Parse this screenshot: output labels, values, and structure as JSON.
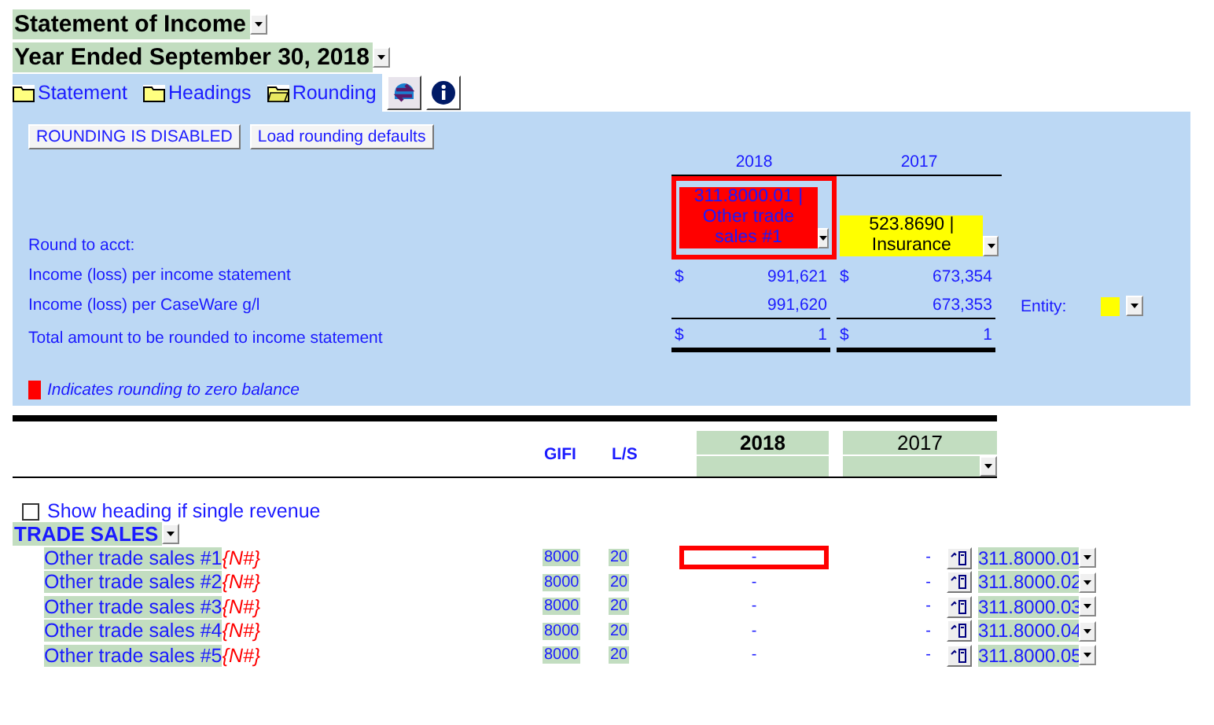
{
  "report_title": "Statement of Income",
  "period": "Year Ended September 30, 2018",
  "tabs": [
    {
      "label": "Statement",
      "selected": false
    },
    {
      "label": "Headings",
      "selected": false
    },
    {
      "label": "Rounding",
      "selected": true
    }
  ],
  "rounding": {
    "buttons": [
      "ROUNDING IS DISABLED",
      "Load rounding defaults"
    ],
    "columns": [
      "2018",
      "2017"
    ],
    "round_to_label": "Round to acct:",
    "round_to": [
      {
        "text": "311.8000.01 | Other trade sales #1",
        "color": "#ff0000",
        "flagged": true
      },
      {
        "text": "523.8690 | Insurance",
        "color": "#ffff00",
        "flagged": false
      }
    ],
    "rows": [
      {
        "label": "Income (loss) per income statement",
        "kind": "dollar",
        "values": [
          {
            "currency": "$",
            "amount": "991,621"
          },
          {
            "currency": "$",
            "amount": "673,354"
          }
        ]
      },
      {
        "label": "Income (loss) per CaseWare g/l",
        "kind": "subtotal",
        "values": [
          {
            "amount": "991,620"
          },
          {
            "amount": "673,353"
          }
        ]
      },
      {
        "label": "Total amount to be rounded to income statement",
        "kind": "total",
        "values": [
          {
            "currency": "$",
            "amount": "1"
          },
          {
            "currency": "$",
            "amount": "1"
          }
        ]
      }
    ],
    "entity": {
      "label": "Entity:",
      "color": "#ffff00"
    },
    "legend": {
      "text": "Indicates rounding to zero balance",
      "color": "#ff0000"
    }
  },
  "table": {
    "columns": {
      "gifi": "GIFI",
      "ls": "L/S",
      "years": [
        "2018",
        "2017"
      ]
    },
    "show_heading": {
      "label": "Show heading if single revenue",
      "checked": false
    },
    "section": "TRADE SALES",
    "rows": [
      {
        "label": "Other trade sales #1",
        "tag": "{N#}",
        "gifi": "8000",
        "ls": "20",
        "values": [
          "-",
          "-"
        ],
        "account": "311.8000.01",
        "flagged": true
      },
      {
        "label": "Other trade sales #2",
        "tag": "{N#}",
        "gifi": "8000",
        "ls": "20",
        "values": [
          "-",
          "-"
        ],
        "account": "311.8000.02",
        "flagged": false
      },
      {
        "label": "Other trade sales #3",
        "tag": "{N#}",
        "gifi": "8000",
        "ls": "20",
        "values": [
          "-",
          "-"
        ],
        "account": "311.8000.03",
        "flagged": false
      },
      {
        "label": "Other trade sales #4",
        "tag": "{N#}",
        "gifi": "8000",
        "ls": "20",
        "values": [
          "-",
          "-"
        ],
        "account": "311.8000.04",
        "flagged": false
      },
      {
        "label": "Other trade sales #5",
        "tag": "{N#}",
        "gifi": "8000",
        "ls": "20",
        "values": [
          "-",
          "-"
        ],
        "account": "311.8000.05",
        "flagged": false
      }
    ]
  }
}
